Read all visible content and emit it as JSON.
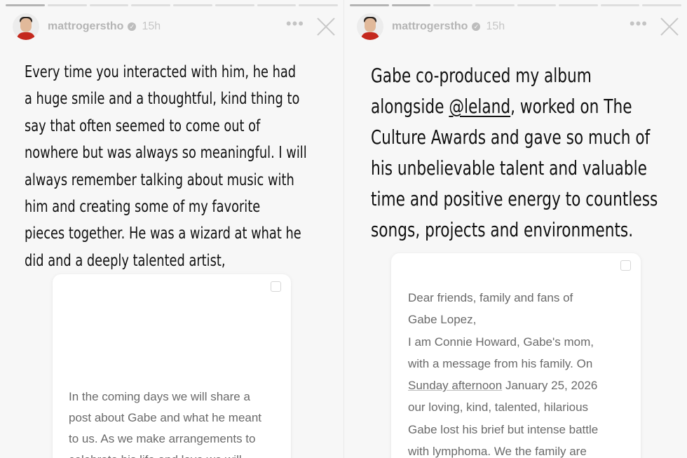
{
  "stories": [
    {
      "user": {
        "username": "mattrogerstho",
        "time": "15h"
      },
      "text_lines": [
        "Every time you interacted with him, he had",
        "a huge smile and a thoughtful, kind thing to",
        "say that often seemed to come out of",
        "nowhere but was always so meaningful. I will",
        "always remember talking about music with",
        "him and creating some of my favorite",
        "pieces together. He was a wizard at what he",
        "did and a deeply talented artist,"
      ],
      "card_lines": [
        "In the coming days we will share a",
        "post about Gabe and what he meant",
        "to us. As we make arrangements to",
        "celebrate his life and love we will"
      ]
    },
    {
      "user": {
        "username": "mattrogerstho",
        "time": "15h"
      },
      "text_lines": [
        "Gabe co-produced my album",
        "alongside",
        "@leland",
        ", worked on The",
        "Culture Awards and gave so much of",
        "his unbelievable talent and valuable",
        "time and positive energy to countless",
        "songs, projects and environments."
      ],
      "card_lines": [
        "Dear friends, family and fans of",
        "Gabe Lopez,",
        "I am Connie Howard, Gabe's mom,",
        "with a message from his family. On",
        "Sunday afternoon",
        " January 25, 2026",
        "our loving, kind, talented, hilarious",
        "Gabe lost his brief but intense battle",
        "with lymphoma. We the family are"
      ]
    }
  ],
  "icons": {
    "more": "more-options-icon",
    "close": "close-icon",
    "verified": "verified-badge-icon",
    "save": "bookmark-icon"
  }
}
